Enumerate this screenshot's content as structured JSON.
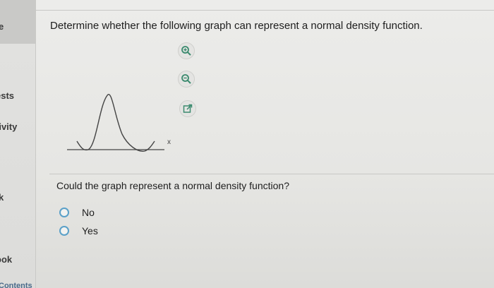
{
  "sidebar": {
    "items": [
      {
        "label": "e"
      },
      {
        "label": "ests"
      },
      {
        "label": "tivity"
      },
      {
        "label": "k"
      },
      {
        "label": "ook"
      },
      {
        "label": "Contents"
      }
    ]
  },
  "question": {
    "title": "Determine whether the following graph can represent a normal density function.",
    "graph_axis_label": "x",
    "prompt": "Could the graph represent a normal density function?",
    "options": [
      {
        "label": "No"
      },
      {
        "label": "Yes"
      }
    ]
  },
  "tools": {
    "icons": [
      "zoom-in-icon",
      "zoom-out-icon",
      "popout-icon"
    ],
    "accent": "#3b8a6e"
  },
  "colors": {
    "radio": "#5aa0c8",
    "sidebar_active": "#c9c9c7"
  }
}
